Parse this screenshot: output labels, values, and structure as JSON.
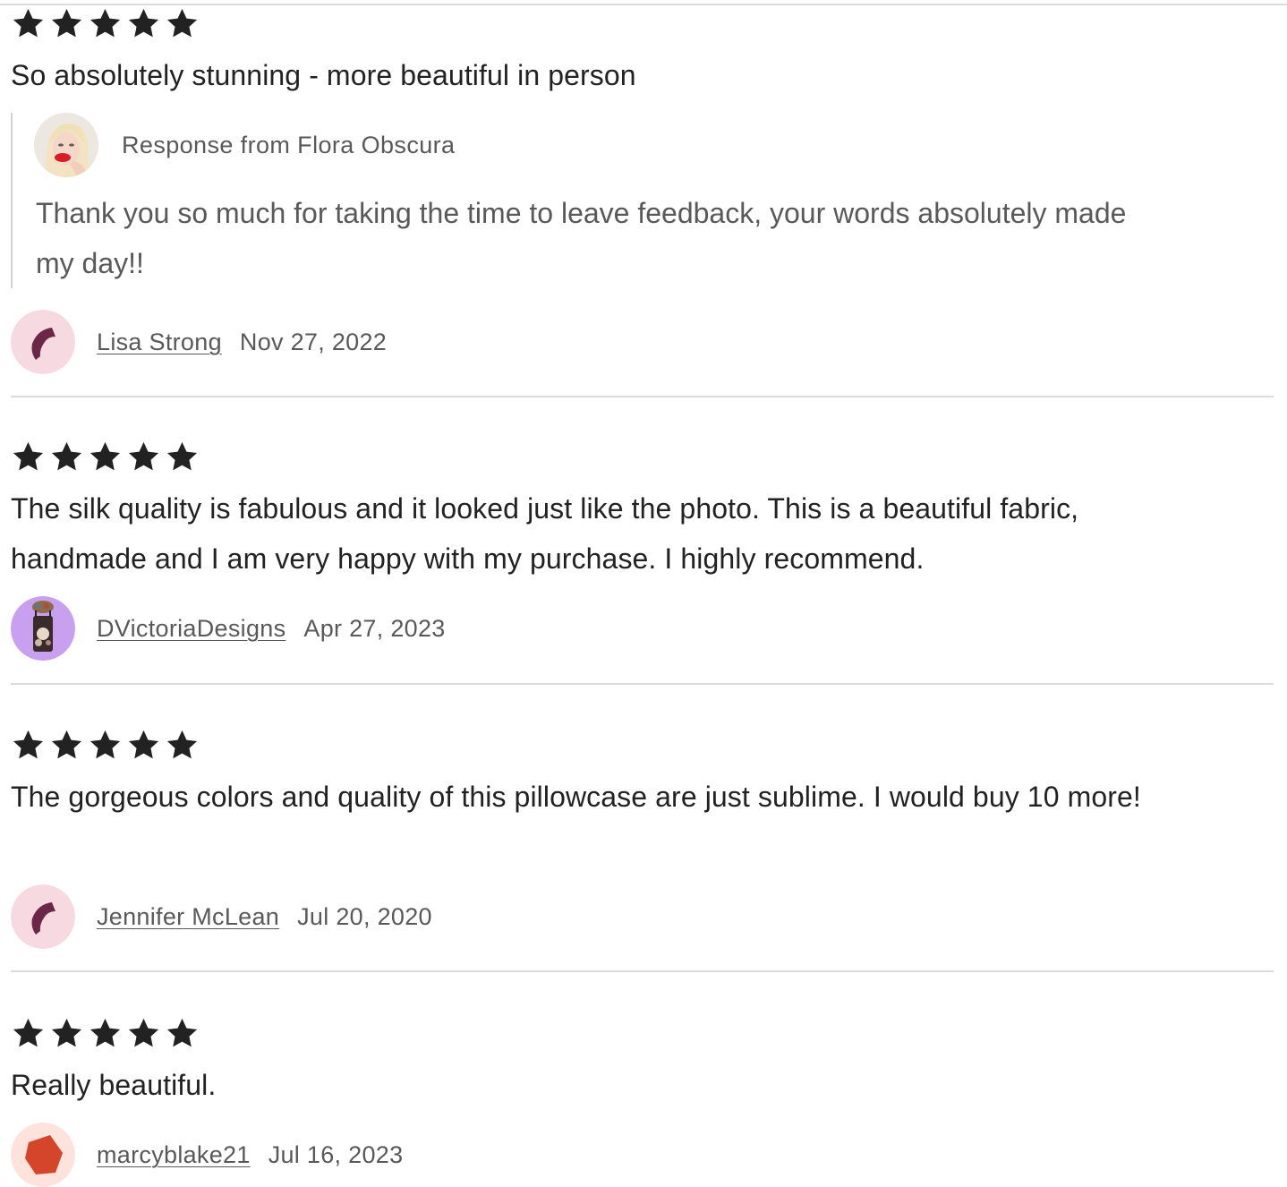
{
  "reviews": [
    {
      "rating": 5,
      "rating_max": 5,
      "text": "So absolutely stunning - more beautiful in person",
      "response": {
        "label": "Response from Flora Obscura",
        "text": "Thank you so much for taking the time to leave feedback, your words absolutely made my day!!"
      },
      "reviewer": "Lisa Strong",
      "date": "Nov 27, 2022",
      "avatar": "default-pink-avatar"
    },
    {
      "rating": 5,
      "rating_max": 5,
      "text": "The silk quality is fabulous and it looked just like the photo. This is a beautiful fabric, handmade and I am very happy with my purchase. I highly recommend.",
      "reviewer": "DVictoriaDesigns",
      "date": "Apr 27, 2023",
      "avatar": "purple-photo-avatar"
    },
    {
      "rating": 5,
      "rating_max": 5,
      "text": "The gorgeous colors and quality of this pillowcase are just sublime. I would buy 10 more!",
      "reviewer": "Jennifer McLean",
      "date": "Jul 20, 2020",
      "avatar": "default-pink-avatar"
    },
    {
      "rating": 5,
      "rating_max": 5,
      "text": "Really beautiful.",
      "reviewer": "marcyblake21",
      "date": "Jul 16, 2023",
      "avatar": "default-red-avatar"
    }
  ],
  "colors": {
    "text": "#222222",
    "muted": "#595959",
    "divider": "#dcdcdc",
    "pink_avatar_bg": "#f6d9e1",
    "pink_avatar_fg": "#6b2648",
    "purple_avatar_bg": "#c99ff0",
    "red_avatar_bg": "#fde3dc",
    "red_avatar_fg": "#d4452a"
  },
  "icons": {
    "star": "filled-star-icon"
  }
}
